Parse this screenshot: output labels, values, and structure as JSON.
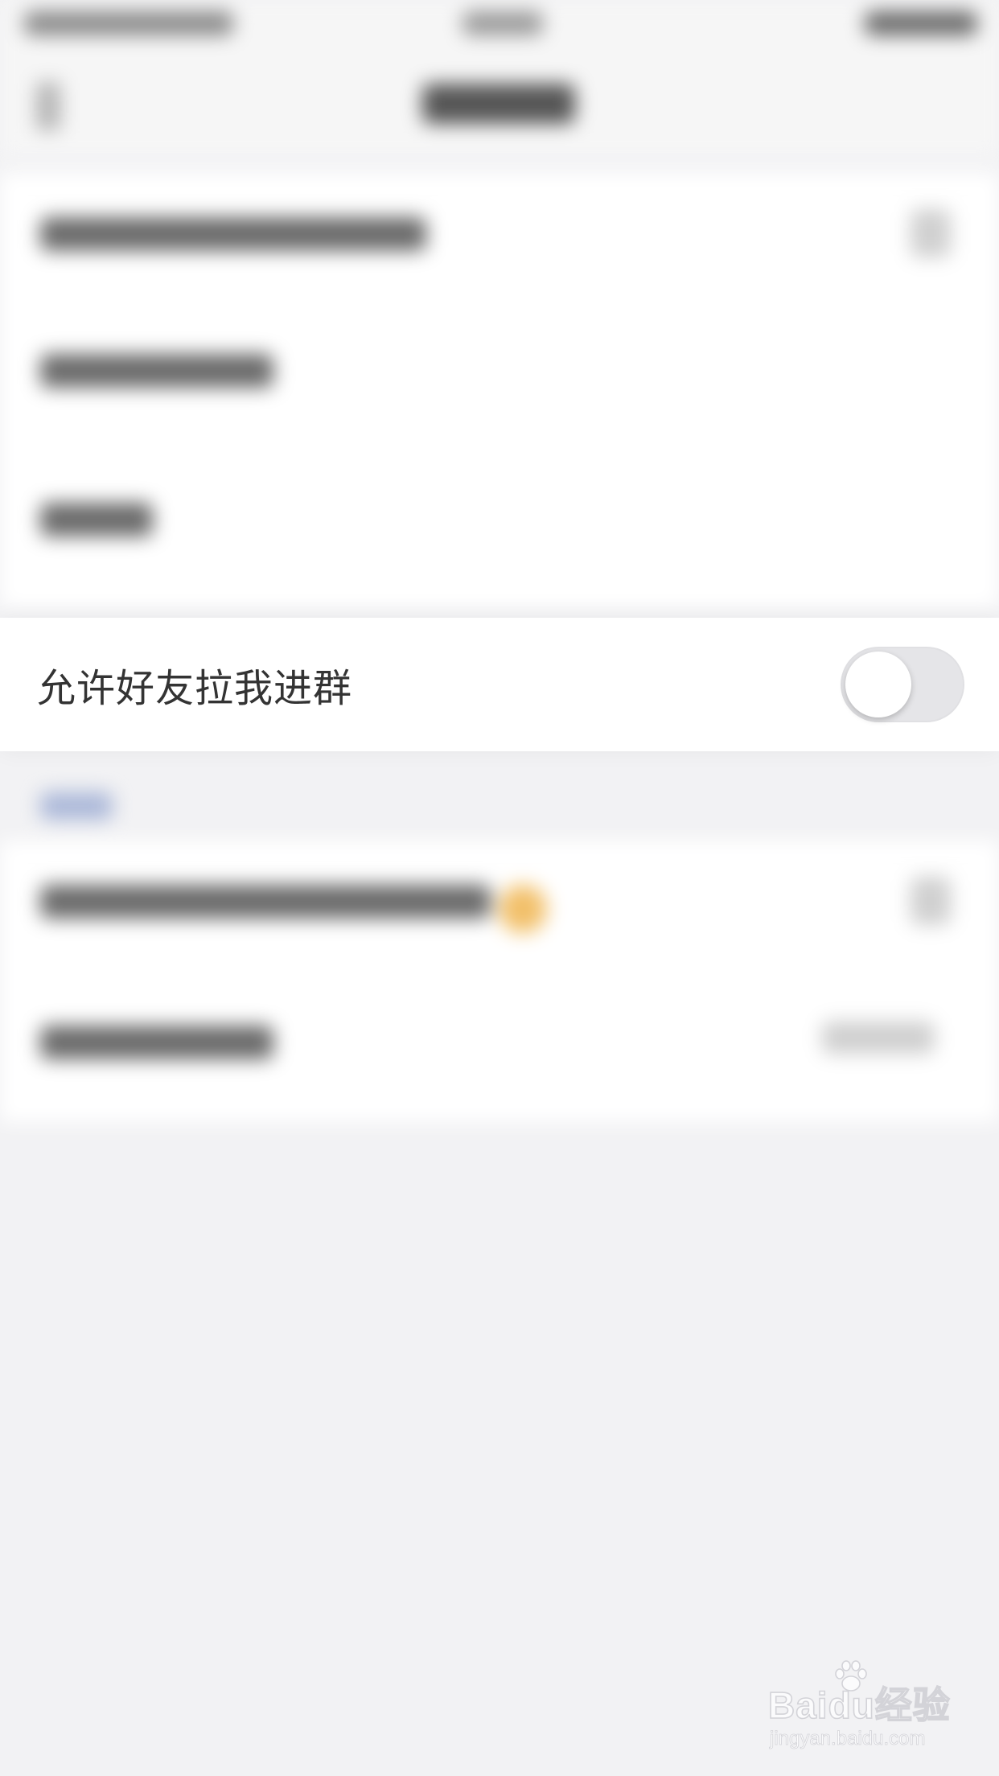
{
  "settings": {
    "allow_friends_invite_to_group": {
      "label": "允许好友拉我进群",
      "enabled": false
    }
  },
  "watermark": {
    "brand": "Baidu经验",
    "url": "jingyan.baidu.com"
  },
  "colors": {
    "page_background": "#f2f2f4",
    "row_background": "#ffffff",
    "label_text": "#333333",
    "toggle_off_track": "#e5e5e8",
    "toggle_knob": "#ffffff"
  },
  "icons": {
    "watermark_logo": "paw-icon"
  }
}
